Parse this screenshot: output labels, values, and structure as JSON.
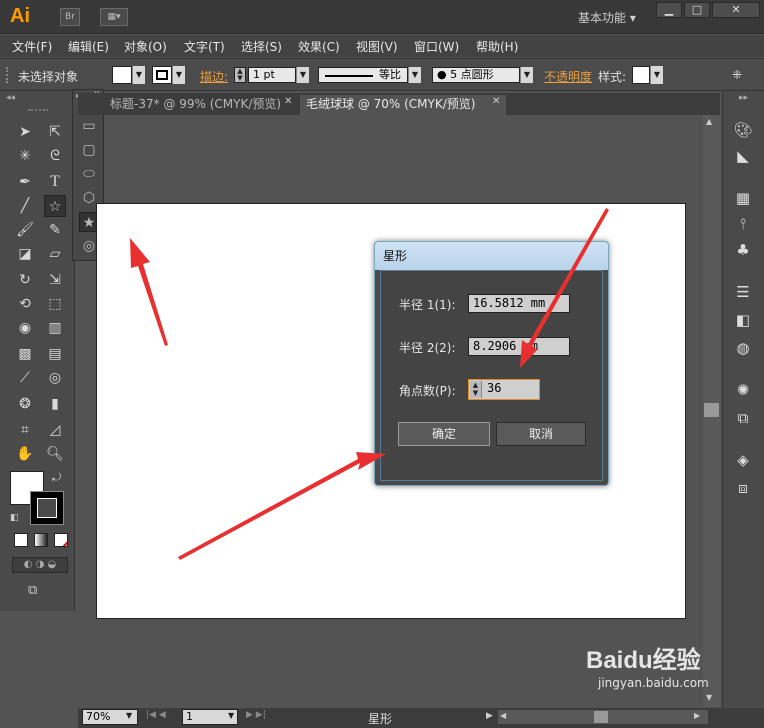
{
  "app": {
    "logo_text": "Ai",
    "bridge_label": "Br",
    "workspace_label": "基本功能 ▾"
  },
  "menu": [
    "文件(F)",
    "编辑(E)",
    "对象(O)",
    "文字(T)",
    "选择(S)",
    "效果(C)",
    "视图(V)",
    "窗口(W)",
    "帮助(H)"
  ],
  "control_bar": {
    "selection_status": "未选择对象",
    "stroke_label": "描边:",
    "stroke_weight": "1 pt",
    "stroke_profile": "等比",
    "brush_label": "5 点圆形",
    "opacity_label": "不透明度",
    "style_label": "样式:"
  },
  "tabs": [
    {
      "label": "标题-37* @ 99% (CMYK/预览)",
      "active": false
    },
    {
      "label": "毛绒球球 @ 70% (CMYK/预览)",
      "active": true
    }
  ],
  "dialog": {
    "title": "星形",
    "radius1_label": "半径 1(1):",
    "radius1_value": "16.5812 mm",
    "radius2_label": "半径 2(2):",
    "radius2_value": "8.2906 mm",
    "points_label": "角点数(P):",
    "points_value": "36",
    "ok_label": "确定",
    "cancel_label": "取消"
  },
  "status_bar": {
    "zoom": "70%",
    "page": "1",
    "tool_name": "星形"
  },
  "watermark": {
    "brand": "Baidu经验",
    "url": "jingyan.baidu.com"
  },
  "colors": {
    "accent_orange": "#ff9a00",
    "arrow_red": "#e83030",
    "dialog_title_blue": "#cfe3f5"
  }
}
